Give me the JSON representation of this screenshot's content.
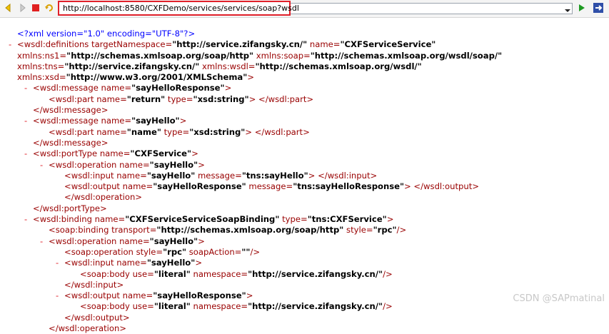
{
  "toolbar": {
    "url": "http://localhost:8580/CXFDemo/services/services/soap?wsdl"
  },
  "xml": [
    {
      "ind": 24,
      "m": false,
      "text": "<?xml version=\"1.0\" encoding=\"UTF-8\"?>",
      "pi": true
    },
    {
      "ind": 24,
      "m": true,
      "parts": [
        [
          "t",
          "<wsdl:definitions "
        ],
        [
          "a",
          "targetNamespace="
        ],
        [
          "v",
          "\"http://service.zifangsky.cn/\""
        ],
        [
          "a",
          " name="
        ],
        [
          "v",
          "\"CXFServiceService\""
        ]
      ]
    },
    {
      "ind": 24,
      "m": false,
      "parts": [
        [
          "a",
          "xmlns:ns1="
        ],
        [
          "v",
          "\"http://schemas.xmlsoap.org/soap/http\""
        ],
        [
          "a",
          " xmlns:soap="
        ],
        [
          "v",
          "\"http://schemas.xmlsoap.org/wsdl/soap/\""
        ]
      ]
    },
    {
      "ind": 24,
      "m": false,
      "parts": [
        [
          "a",
          "xmlns:tns="
        ],
        [
          "v",
          "\"http://service.zifangsky.cn/\""
        ],
        [
          "a",
          " xmlns:wsdl="
        ],
        [
          "v",
          "\"http://schemas.xmlsoap.org/wsdl/\""
        ]
      ]
    },
    {
      "ind": 24,
      "m": false,
      "parts": [
        [
          "a",
          "xmlns:xsd="
        ],
        [
          "v",
          "\"http://www.w3.org/2001/XMLSchema\""
        ],
        [
          "t",
          ">"
        ]
      ]
    },
    {
      "ind": 46,
      "m": true,
      "parts": [
        [
          "t",
          "<wsdl:message "
        ],
        [
          "a",
          "name="
        ],
        [
          "v",
          "\"sayHelloResponse\""
        ],
        [
          "t",
          ">"
        ]
      ]
    },
    {
      "ind": 68,
      "m": false,
      "parts": [
        [
          "t",
          "<wsdl:part "
        ],
        [
          "a",
          "name="
        ],
        [
          "v",
          "\"return\""
        ],
        [
          "a",
          " type="
        ],
        [
          "v",
          "\"xsd:string\""
        ],
        [
          "t",
          "> </wsdl:part>"
        ]
      ]
    },
    {
      "ind": 46,
      "m": false,
      "parts": [
        [
          "t",
          "</wsdl:message>"
        ]
      ]
    },
    {
      "ind": 46,
      "m": true,
      "parts": [
        [
          "t",
          "<wsdl:message "
        ],
        [
          "a",
          "name="
        ],
        [
          "v",
          "\"sayHello\""
        ],
        [
          "t",
          ">"
        ]
      ]
    },
    {
      "ind": 68,
      "m": false,
      "parts": [
        [
          "t",
          "<wsdl:part "
        ],
        [
          "a",
          "name="
        ],
        [
          "v",
          "\"name\""
        ],
        [
          "a",
          " type="
        ],
        [
          "v",
          "\"xsd:string\""
        ],
        [
          "t",
          "> </wsdl:part>"
        ]
      ]
    },
    {
      "ind": 46,
      "m": false,
      "parts": [
        [
          "t",
          "</wsdl:message>"
        ]
      ]
    },
    {
      "ind": 46,
      "m": true,
      "parts": [
        [
          "t",
          "<wsdl:portType "
        ],
        [
          "a",
          "name="
        ],
        [
          "v",
          "\"CXFService\""
        ],
        [
          "t",
          ">"
        ]
      ]
    },
    {
      "ind": 68,
      "m": true,
      "parts": [
        [
          "t",
          "<wsdl:operation "
        ],
        [
          "a",
          "name="
        ],
        [
          "v",
          "\"sayHello\""
        ],
        [
          "t",
          ">"
        ]
      ]
    },
    {
      "ind": 90,
      "m": false,
      "parts": [
        [
          "t",
          "<wsdl:input "
        ],
        [
          "a",
          "name="
        ],
        [
          "v",
          "\"sayHello\""
        ],
        [
          "a",
          " message="
        ],
        [
          "v",
          "\"tns:sayHello\""
        ],
        [
          "t",
          "> </wsdl:input>"
        ]
      ]
    },
    {
      "ind": 90,
      "m": false,
      "parts": [
        [
          "t",
          "<wsdl:output "
        ],
        [
          "a",
          "name="
        ],
        [
          "v",
          "\"sayHelloResponse\""
        ],
        [
          "a",
          " message="
        ],
        [
          "v",
          "\"tns:sayHelloResponse\""
        ],
        [
          "t",
          "> </wsdl:output>"
        ]
      ]
    },
    {
      "ind": 90,
      "m": false,
      "parts": [
        [
          "t",
          "</wsdl:operation>"
        ]
      ]
    },
    {
      "ind": 46,
      "m": false,
      "parts": [
        [
          "t",
          "</wsdl:portType>"
        ]
      ]
    },
    {
      "ind": 46,
      "m": true,
      "parts": [
        [
          "t",
          "<wsdl:binding "
        ],
        [
          "a",
          "name="
        ],
        [
          "v",
          "\"CXFServiceServiceSoapBinding\""
        ],
        [
          "a",
          " type="
        ],
        [
          "v",
          "\"tns:CXFService\""
        ],
        [
          "t",
          ">"
        ]
      ]
    },
    {
      "ind": 68,
      "m": false,
      "parts": [
        [
          "t",
          "<soap:binding "
        ],
        [
          "a",
          "transport="
        ],
        [
          "v",
          "\"http://schemas.xmlsoap.org/soap/http\""
        ],
        [
          "a",
          " style="
        ],
        [
          "v",
          "\"rpc\""
        ],
        [
          "t",
          "/>"
        ]
      ]
    },
    {
      "ind": 68,
      "m": true,
      "parts": [
        [
          "t",
          "<wsdl:operation "
        ],
        [
          "a",
          "name="
        ],
        [
          "v",
          "\"sayHello\""
        ],
        [
          "t",
          ">"
        ]
      ]
    },
    {
      "ind": 90,
      "m": false,
      "parts": [
        [
          "t",
          "<soap:operation "
        ],
        [
          "a",
          "style="
        ],
        [
          "v",
          "\"rpc\""
        ],
        [
          "a",
          " soapAction="
        ],
        [
          "v",
          "\"\""
        ],
        [
          "t",
          "/>"
        ]
      ]
    },
    {
      "ind": 90,
      "m": true,
      "parts": [
        [
          "t",
          "<wsdl:input "
        ],
        [
          "a",
          "name="
        ],
        [
          "v",
          "\"sayHello\""
        ],
        [
          "t",
          ">"
        ]
      ]
    },
    {
      "ind": 112,
      "m": false,
      "parts": [
        [
          "t",
          "<soap:body "
        ],
        [
          "a",
          "use="
        ],
        [
          "v",
          "\"literal\""
        ],
        [
          "a",
          " namespace="
        ],
        [
          "v",
          "\"http://service.zifangsky.cn/\""
        ],
        [
          "t",
          "/>"
        ]
      ]
    },
    {
      "ind": 90,
      "m": false,
      "parts": [
        [
          "t",
          "</wsdl:input>"
        ]
      ]
    },
    {
      "ind": 90,
      "m": true,
      "parts": [
        [
          "t",
          "<wsdl:output "
        ],
        [
          "a",
          "name="
        ],
        [
          "v",
          "\"sayHelloResponse\""
        ],
        [
          "t",
          ">"
        ]
      ]
    },
    {
      "ind": 112,
      "m": false,
      "parts": [
        [
          "t",
          "<soap:body "
        ],
        [
          "a",
          "use="
        ],
        [
          "v",
          "\"literal\""
        ],
        [
          "a",
          " namespace="
        ],
        [
          "v",
          "\"http://service.zifangsky.cn/\""
        ],
        [
          "t",
          "/>"
        ]
      ]
    },
    {
      "ind": 90,
      "m": false,
      "parts": [
        [
          "t",
          "</wsdl:output>"
        ]
      ]
    },
    {
      "ind": 68,
      "m": false,
      "parts": [
        [
          "t",
          "</wsdl:operation>"
        ]
      ]
    }
  ],
  "watermark": "CSDN @SAPmatinal"
}
